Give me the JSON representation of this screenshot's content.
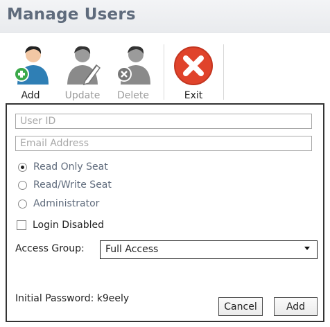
{
  "header": {
    "title": "Manage Users"
  },
  "toolbar": {
    "add_label": "Add",
    "update_label": "Update",
    "delete_label": "Delete",
    "exit_label": "Exit"
  },
  "form": {
    "user_id_placeholder": "User ID",
    "email_placeholder": "Email Address",
    "seat_options": [
      {
        "label": "Read Only Seat",
        "checked": true
      },
      {
        "label": "Read/Write Seat",
        "checked": false
      },
      {
        "label": "Administrator",
        "checked": false
      }
    ],
    "login_disabled_label": "Login Disabled",
    "access_group_label": "Access Group:",
    "access_group_value": "Full Access",
    "initial_password_label": "Initial Password: k9eely",
    "cancel_label": "Cancel",
    "add_label": "Add"
  },
  "colors": {
    "title": "#5f6b7c",
    "add_person": "#2f7fb5",
    "add_badge": "#3ba94a",
    "disabled_person": "#8a8a8a",
    "exit": "#e0432b"
  }
}
